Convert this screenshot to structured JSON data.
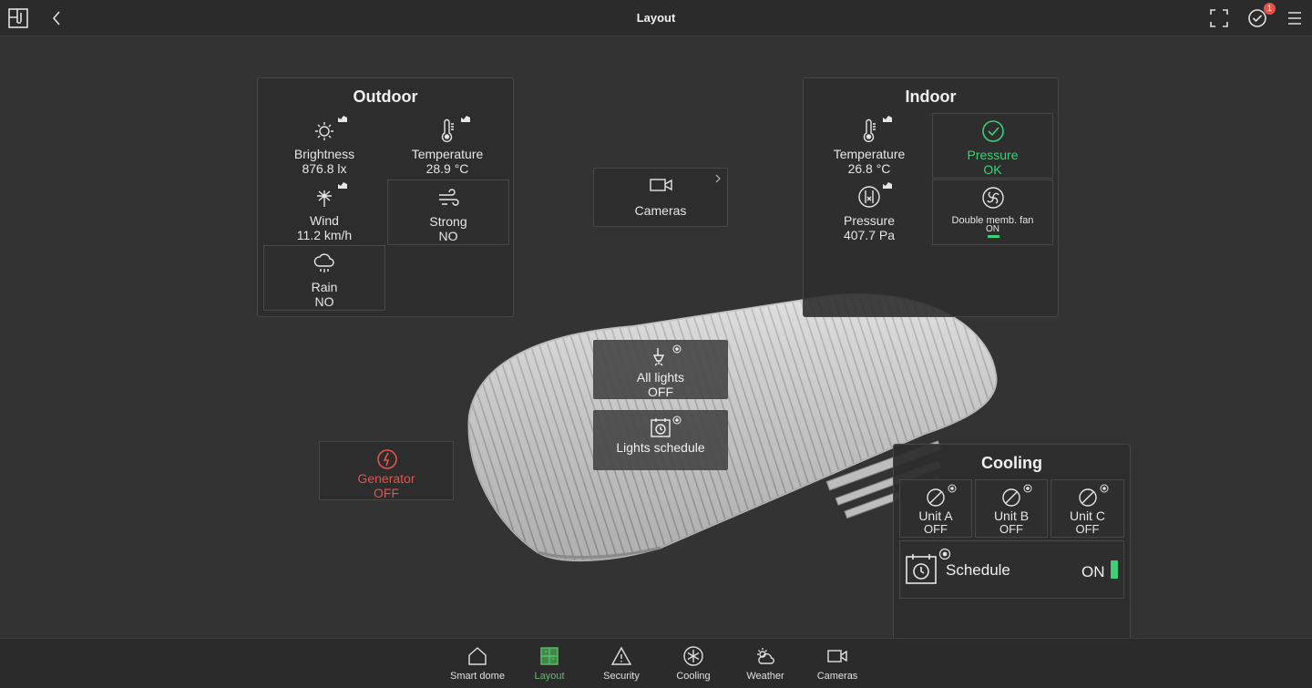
{
  "header": {
    "title": "Layout",
    "notification_count": "1"
  },
  "outdoor": {
    "title": "Outdoor",
    "brightness": {
      "label": "Brightness",
      "value": "876.8 lx"
    },
    "temperature": {
      "label": "Temperature",
      "value": "28.9 °C"
    },
    "wind": {
      "label": "Wind",
      "value": "11.2 km/h"
    },
    "strong": {
      "label": "Strong",
      "value": "NO"
    },
    "rain": {
      "label": "Rain",
      "value": "NO"
    }
  },
  "cameras_card": {
    "label": "Cameras"
  },
  "indoor": {
    "title": "Indoor",
    "temperature": {
      "label": "Temperature",
      "value": "26.8 °C"
    },
    "pressure_status": {
      "label": "Pressure",
      "value": "OK"
    },
    "pressure": {
      "label": "Pressure",
      "value": "407.7 Pa"
    },
    "fan": {
      "label": "Double memb. fan",
      "value": "ON"
    }
  },
  "lights": {
    "all": {
      "label": "All lights",
      "value": "OFF"
    },
    "schedule": {
      "label": "Lights schedule"
    }
  },
  "generator": {
    "label": "Generator",
    "value": "OFF"
  },
  "cooling": {
    "title": "Cooling",
    "units": [
      {
        "label": "Unit A",
        "value": "OFF"
      },
      {
        "label": "Unit B",
        "value": "OFF"
      },
      {
        "label": "Unit C",
        "value": "OFF"
      }
    ],
    "schedule": {
      "label": "Schedule",
      "value": "ON"
    }
  },
  "nav": [
    {
      "label": "Smart dome",
      "icon": "home-icon"
    },
    {
      "label": "Layout",
      "icon": "layout-icon"
    },
    {
      "label": "Security",
      "icon": "warning-icon"
    },
    {
      "label": "Cooling",
      "icon": "snowflake-icon"
    },
    {
      "label": "Weather",
      "icon": "weather-icon"
    },
    {
      "label": "Cameras",
      "icon": "camera-icon"
    }
  ],
  "colors": {
    "accent": "#3ecf78",
    "alert": "#e5534b",
    "nav_active": "#5cbf6a"
  }
}
